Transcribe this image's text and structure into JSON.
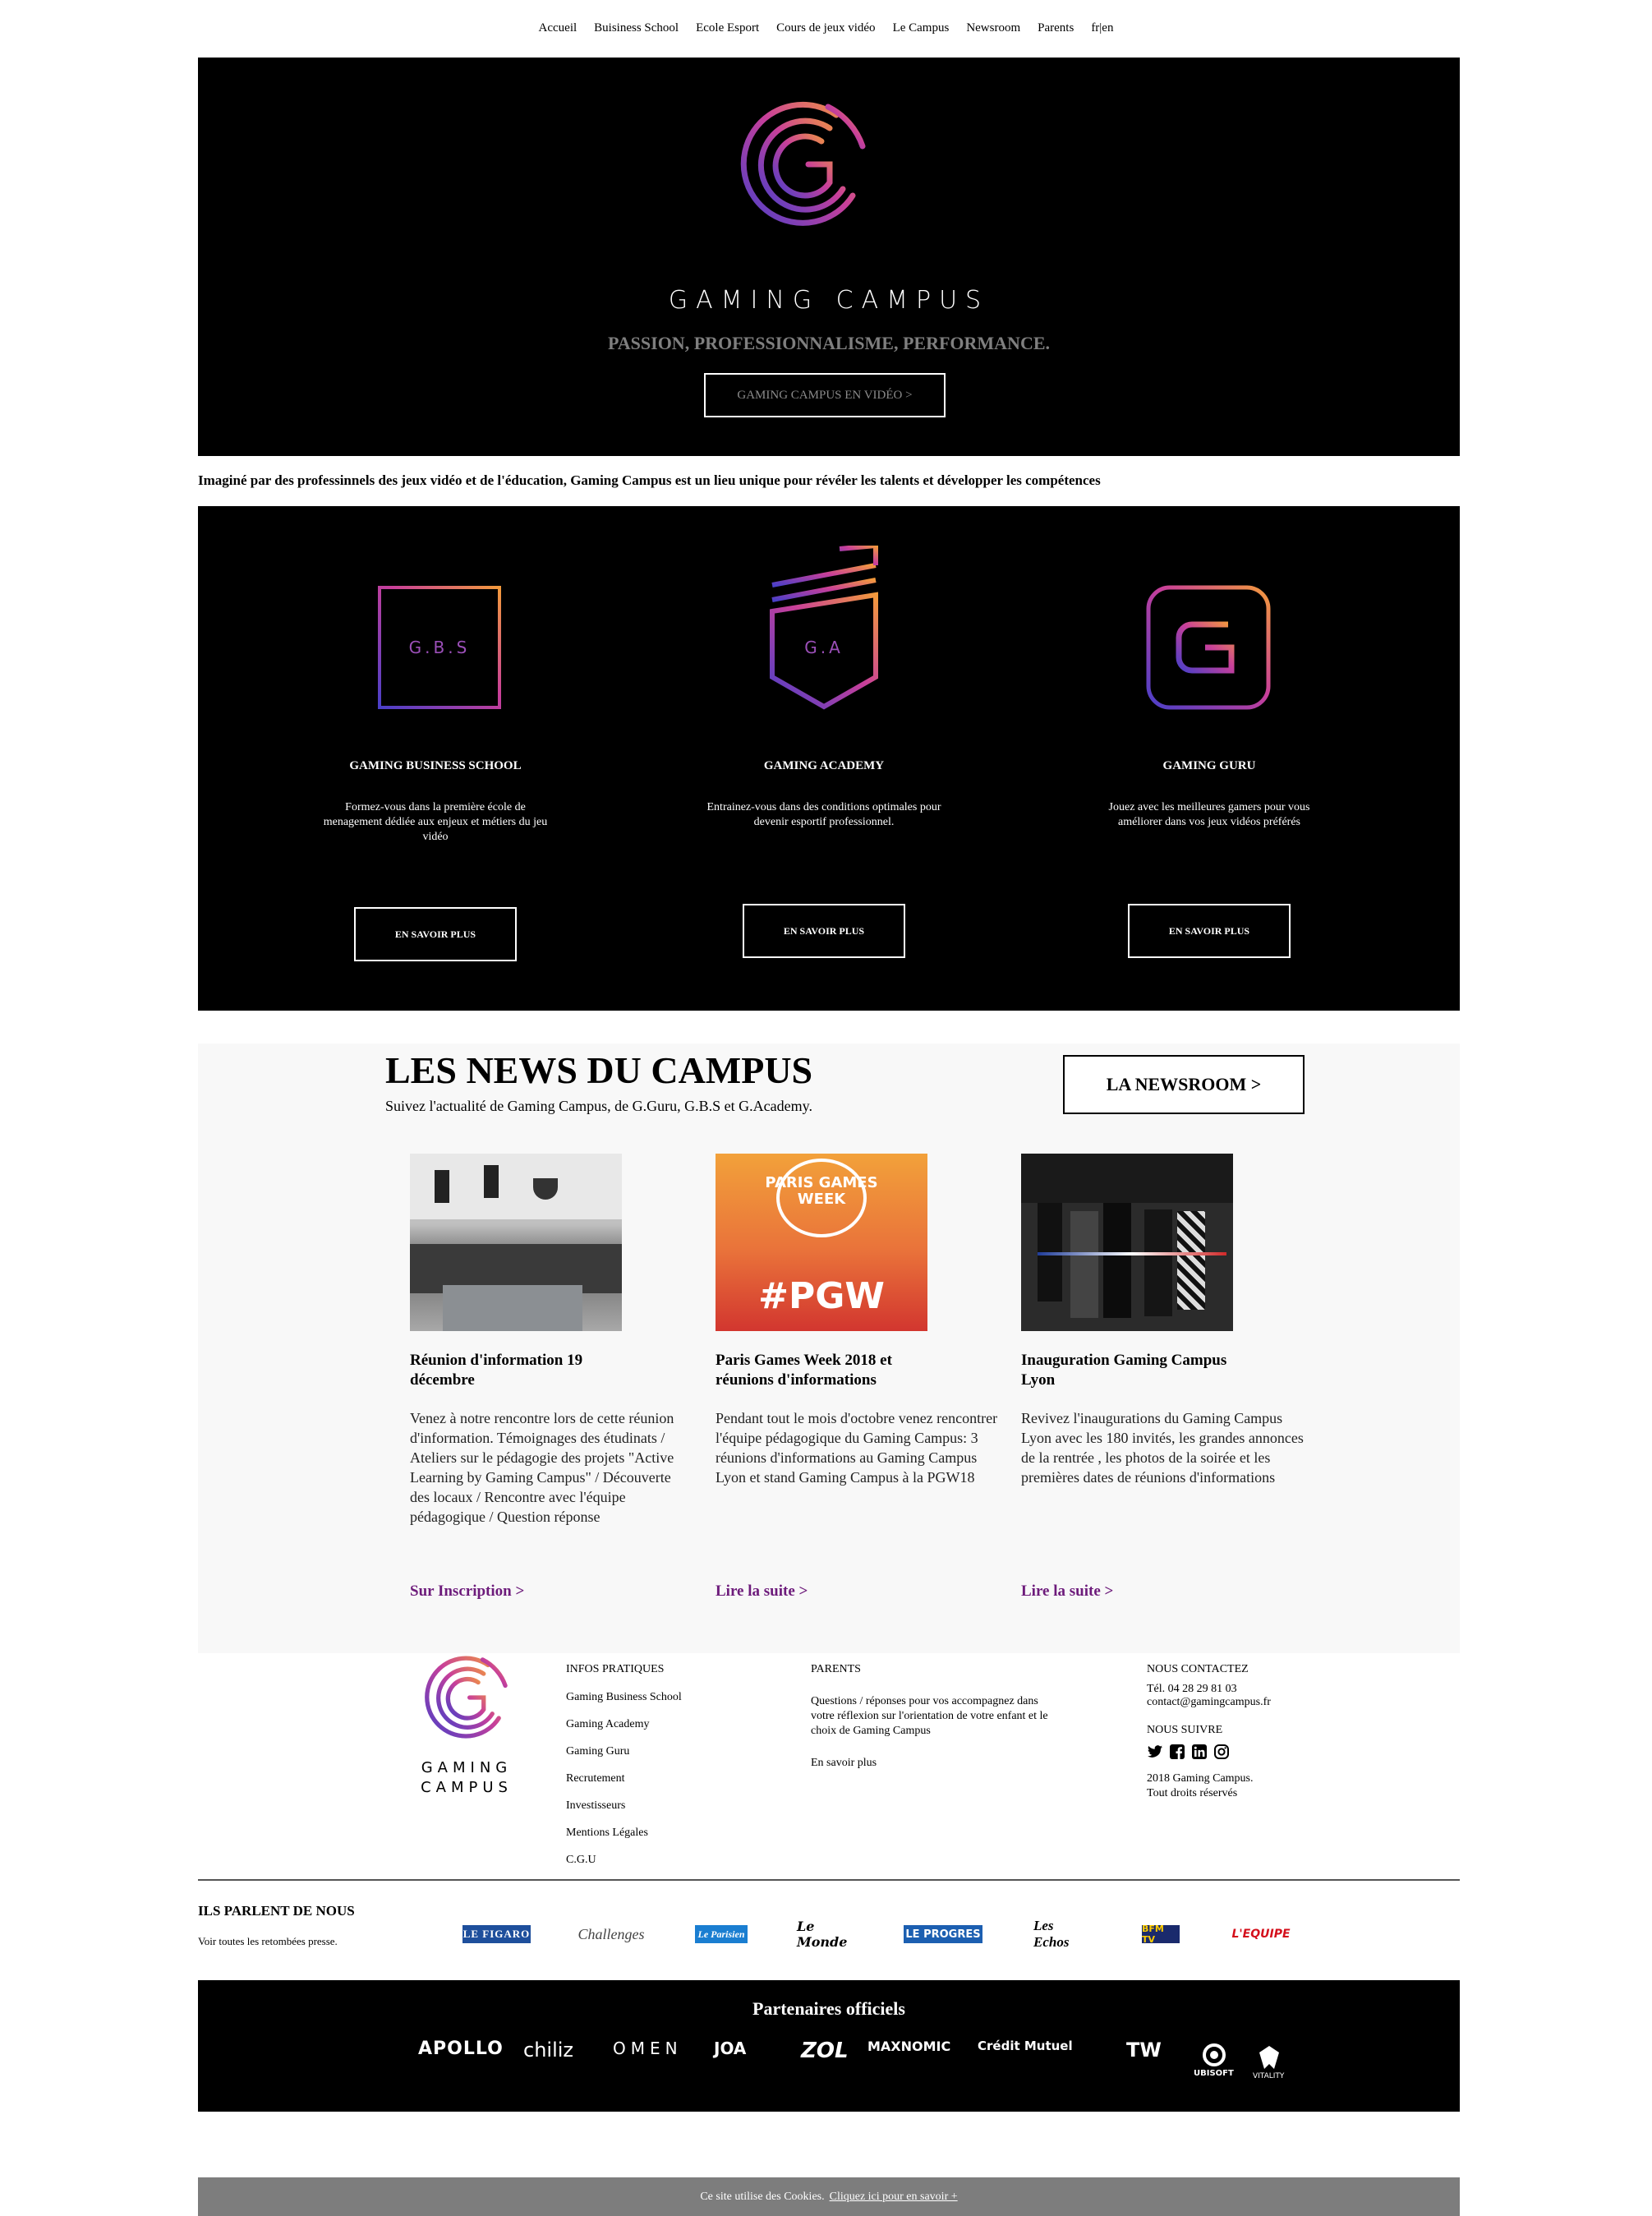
{
  "nav": [
    "Accueil",
    "Buisiness School",
    "Ecole Esport",
    "Cours de jeux vidéo",
    "Le Campus",
    "Newsroom",
    "Parents",
    "fr|en"
  ],
  "hero": {
    "title": "GAMING CAMPUS",
    "subtitle": "PASSION, PROFESSIONNALISME, PERFORMANCE.",
    "button": "GAMING CAMPUS EN VIDÉO >"
  },
  "intro": "Imaginé par des professinnels des jeux vidéo et de l'éducation, Gaming Campus est un lieu unique pour révéler les talents et développer les compétences",
  "schools": [
    {
      "badge": "G.B.S",
      "name": "GAMING BUSINESS SCHOOL",
      "desc": "Formez-vous dans la première école de menagement dédiée aux enjeux et métiers du jeu vidéo",
      "button": "EN SAVOIR PLUS"
    },
    {
      "badge": "G.A",
      "name": "GAMING ACADEMY",
      "desc": "Entrainez-vous dans des conditions optimales pour devenir esportif professionnel.",
      "button": "EN SAVOIR PLUS"
    },
    {
      "badge": "G",
      "name": "GAMING GURU",
      "desc": "Jouez avec les meilleures gamers pour vous améliorer dans vos jeux vidéos préférés",
      "button": "EN SAVOIR PLUS"
    }
  ],
  "news": {
    "title": "LES NEWS DU CAMPUS",
    "subtitle": "Suivez l'actualité de Gaming Campus, de G.Guru, G.B.S et G.Academy.",
    "button": "LA NEWSROOM >",
    "cards": [
      {
        "title": "Réunion d'information 19 décembre",
        "desc": "Venez à notre rencontre lors de cette réunion d'information. Témoignages des étudinats / Ateliers sur le pédagogie des projets \"Active Learning by Gaming Campus\" / Découverte des locaux / Rencontre avec l'équipe pédagogique / Question réponse",
        "link": "Sur Inscription >"
      },
      {
        "title": "Paris Games Week 2018 et réunions d'informations",
        "desc": "Pendant tout le mois d'octobre venez rencontrer l'équipe pédagogique du Gaming Campus: 3 réunions d'informations au Gaming Campus Lyon et stand Gaming Campus à la PGW18",
        "link": "Lire la suite >",
        "img_text_top": "PARIS GAMES WEEK",
        "img_text_bottom": "#PGW"
      },
      {
        "title": "Inauguration Gaming Campus Lyon",
        "desc": "Revivez l'inaugurations du Gaming Campus Lyon avec les 180 invités, les grandes annonces de la rentrée , les photos de la soirée et les premières dates de réunions d'informations",
        "link": "Lire la suite >"
      }
    ]
  },
  "footer": {
    "logo_line1": "GAMING",
    "logo_line2": "CAMPUS",
    "infos_title": "INFOS PRATIQUES",
    "infos_links": [
      "Gaming Business School",
      "Gaming Academy",
      "Gaming Guru",
      "Recrutement",
      "Investisseurs",
      "Mentions Légales",
      "C.G.U"
    ],
    "parents_title": "PARENTS",
    "parents_text": "Questions / réponses pour vos accompagnez dans votre réflexion sur l'orientation de votre enfant et le choix de Gaming Campus",
    "parents_link": "En savoir plus",
    "contact_title": "NOUS CONTACTEZ",
    "phone": "Tél. 04 28 29 81 03",
    "email": "contact@gamingcampus.fr",
    "follow_title": "NOUS SUIVRE",
    "copyright1": "2018 Gaming Campus.",
    "copyright2": "Tout droits réservés"
  },
  "press": {
    "title": "ILS PARLENT DE NOUS",
    "subtitle": "Voir toutes les retombées presse.",
    "logos": [
      "LE FIGARO",
      "Challenges",
      "Le Parisien",
      "Le Monde",
      "LE PROGRES",
      "Les Echos",
      "BFM TV",
      "L'EQUIPE"
    ]
  },
  "partners": {
    "title": "Partenaires officiels",
    "logos": [
      "APOLLO",
      "chiliz",
      "OMEN",
      "JOA",
      "ZOL",
      "MAXNOMIC",
      "Crédit Mutuel",
      "TW",
      "UBISOFT",
      "VITALITY"
    ]
  },
  "cookie": {
    "text": "Ce site utilise des Cookies.",
    "link": "Cliquez ici pour en savoir +"
  },
  "colors": {
    "accent_purple": "#6d1b7b",
    "gradient_a": "#4a3fc8",
    "gradient_b": "#e0406a",
    "gradient_c": "#f39a3c"
  }
}
